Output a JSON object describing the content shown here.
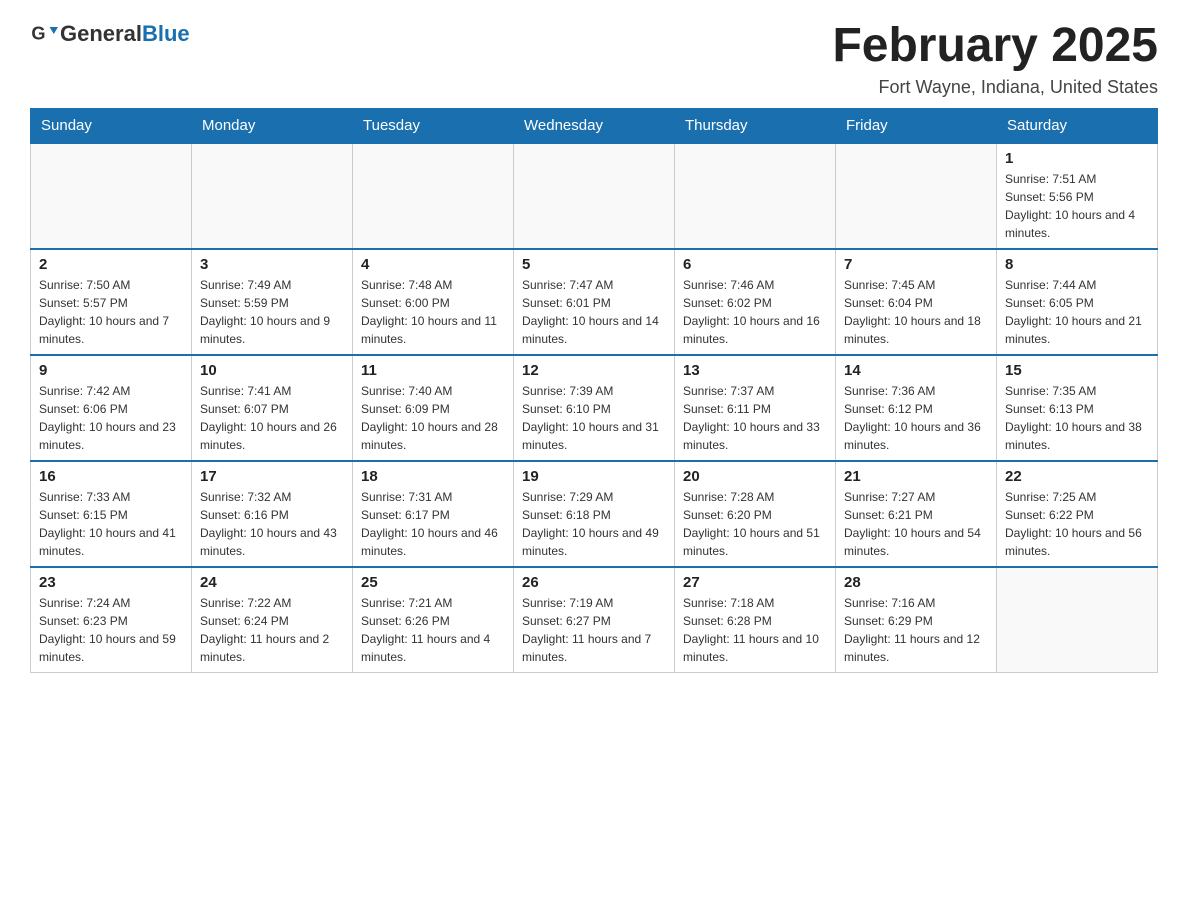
{
  "header": {
    "logo_general": "General",
    "logo_blue": "Blue",
    "month_title": "February 2025",
    "location": "Fort Wayne, Indiana, United States"
  },
  "days_of_week": [
    "Sunday",
    "Monday",
    "Tuesday",
    "Wednesday",
    "Thursday",
    "Friday",
    "Saturday"
  ],
  "weeks": [
    [
      {
        "day": "",
        "info": ""
      },
      {
        "day": "",
        "info": ""
      },
      {
        "day": "",
        "info": ""
      },
      {
        "day": "",
        "info": ""
      },
      {
        "day": "",
        "info": ""
      },
      {
        "day": "",
        "info": ""
      },
      {
        "day": "1",
        "info": "Sunrise: 7:51 AM\nSunset: 5:56 PM\nDaylight: 10 hours and 4 minutes."
      }
    ],
    [
      {
        "day": "2",
        "info": "Sunrise: 7:50 AM\nSunset: 5:57 PM\nDaylight: 10 hours and 7 minutes."
      },
      {
        "day": "3",
        "info": "Sunrise: 7:49 AM\nSunset: 5:59 PM\nDaylight: 10 hours and 9 minutes."
      },
      {
        "day": "4",
        "info": "Sunrise: 7:48 AM\nSunset: 6:00 PM\nDaylight: 10 hours and 11 minutes."
      },
      {
        "day": "5",
        "info": "Sunrise: 7:47 AM\nSunset: 6:01 PM\nDaylight: 10 hours and 14 minutes."
      },
      {
        "day": "6",
        "info": "Sunrise: 7:46 AM\nSunset: 6:02 PM\nDaylight: 10 hours and 16 minutes."
      },
      {
        "day": "7",
        "info": "Sunrise: 7:45 AM\nSunset: 6:04 PM\nDaylight: 10 hours and 18 minutes."
      },
      {
        "day": "8",
        "info": "Sunrise: 7:44 AM\nSunset: 6:05 PM\nDaylight: 10 hours and 21 minutes."
      }
    ],
    [
      {
        "day": "9",
        "info": "Sunrise: 7:42 AM\nSunset: 6:06 PM\nDaylight: 10 hours and 23 minutes."
      },
      {
        "day": "10",
        "info": "Sunrise: 7:41 AM\nSunset: 6:07 PM\nDaylight: 10 hours and 26 minutes."
      },
      {
        "day": "11",
        "info": "Sunrise: 7:40 AM\nSunset: 6:09 PM\nDaylight: 10 hours and 28 minutes."
      },
      {
        "day": "12",
        "info": "Sunrise: 7:39 AM\nSunset: 6:10 PM\nDaylight: 10 hours and 31 minutes."
      },
      {
        "day": "13",
        "info": "Sunrise: 7:37 AM\nSunset: 6:11 PM\nDaylight: 10 hours and 33 minutes."
      },
      {
        "day": "14",
        "info": "Sunrise: 7:36 AM\nSunset: 6:12 PM\nDaylight: 10 hours and 36 minutes."
      },
      {
        "day": "15",
        "info": "Sunrise: 7:35 AM\nSunset: 6:13 PM\nDaylight: 10 hours and 38 minutes."
      }
    ],
    [
      {
        "day": "16",
        "info": "Sunrise: 7:33 AM\nSunset: 6:15 PM\nDaylight: 10 hours and 41 minutes."
      },
      {
        "day": "17",
        "info": "Sunrise: 7:32 AM\nSunset: 6:16 PM\nDaylight: 10 hours and 43 minutes."
      },
      {
        "day": "18",
        "info": "Sunrise: 7:31 AM\nSunset: 6:17 PM\nDaylight: 10 hours and 46 minutes."
      },
      {
        "day": "19",
        "info": "Sunrise: 7:29 AM\nSunset: 6:18 PM\nDaylight: 10 hours and 49 minutes."
      },
      {
        "day": "20",
        "info": "Sunrise: 7:28 AM\nSunset: 6:20 PM\nDaylight: 10 hours and 51 minutes."
      },
      {
        "day": "21",
        "info": "Sunrise: 7:27 AM\nSunset: 6:21 PM\nDaylight: 10 hours and 54 minutes."
      },
      {
        "day": "22",
        "info": "Sunrise: 7:25 AM\nSunset: 6:22 PM\nDaylight: 10 hours and 56 minutes."
      }
    ],
    [
      {
        "day": "23",
        "info": "Sunrise: 7:24 AM\nSunset: 6:23 PM\nDaylight: 10 hours and 59 minutes."
      },
      {
        "day": "24",
        "info": "Sunrise: 7:22 AM\nSunset: 6:24 PM\nDaylight: 11 hours and 2 minutes."
      },
      {
        "day": "25",
        "info": "Sunrise: 7:21 AM\nSunset: 6:26 PM\nDaylight: 11 hours and 4 minutes."
      },
      {
        "day": "26",
        "info": "Sunrise: 7:19 AM\nSunset: 6:27 PM\nDaylight: 11 hours and 7 minutes."
      },
      {
        "day": "27",
        "info": "Sunrise: 7:18 AM\nSunset: 6:28 PM\nDaylight: 11 hours and 10 minutes."
      },
      {
        "day": "28",
        "info": "Sunrise: 7:16 AM\nSunset: 6:29 PM\nDaylight: 11 hours and 12 minutes."
      },
      {
        "day": "",
        "info": ""
      }
    ]
  ]
}
